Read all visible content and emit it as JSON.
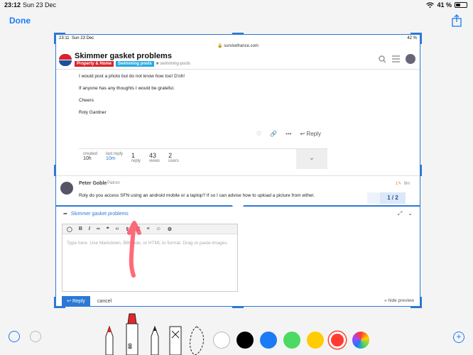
{
  "ios_status": {
    "time": "23:12",
    "date": "Sun 23 Dec",
    "battery": "41 %",
    "battery_level": 0.41
  },
  "toolbar": {
    "done_label": "Done"
  },
  "screenshot": {
    "status": {
      "time": "23:11",
      "date": "Sun 23 Dec",
      "battery": "42 %"
    },
    "url": "survivefrance.com",
    "header": {
      "title": "Skimmer gasket problems",
      "tag_category": "Property & Home",
      "tag_sub": "Swimming pools",
      "tag_extra": "swimming-pools"
    },
    "post": {
      "lines": [
        "I would post a photo but do not know how too! D'oh!",
        "If anyone has any thoughts I would be grateful.",
        "Cheers",
        "Roly Gardner"
      ],
      "reply_label": "Reply"
    },
    "meta": {
      "created_label": "created",
      "created_value": "10h",
      "last_reply_label": "last reply",
      "last_reply_value": "10m",
      "replies_count": "1",
      "replies_label": "reply",
      "views_count": "43",
      "views_label": "views",
      "users_count": "2",
      "users_label": "users"
    },
    "reply_post": {
      "name": "Peter Goble",
      "role": "Patron",
      "time": "9m",
      "edit_count": "1",
      "body": "Roly do you access SFN using an android mobile or a laptop? If so I can advise how to upload a picture from either."
    },
    "progress": "1 / 2",
    "composer": {
      "title": "Skimmer gasket problems",
      "placeholder": "Type here. Use Markdown, BBCode, or HTML to format. Drag or paste images.",
      "reply_label": "Reply",
      "cancel_label": "cancel",
      "hide_preview_label": "« hide preview"
    }
  },
  "markup_tools": {
    "pen_label": "80",
    "colors": [
      "#ffffff",
      "#000000",
      "#1b7bf5",
      "#4cd964",
      "#ffcc00",
      "#ff3b30"
    ]
  }
}
